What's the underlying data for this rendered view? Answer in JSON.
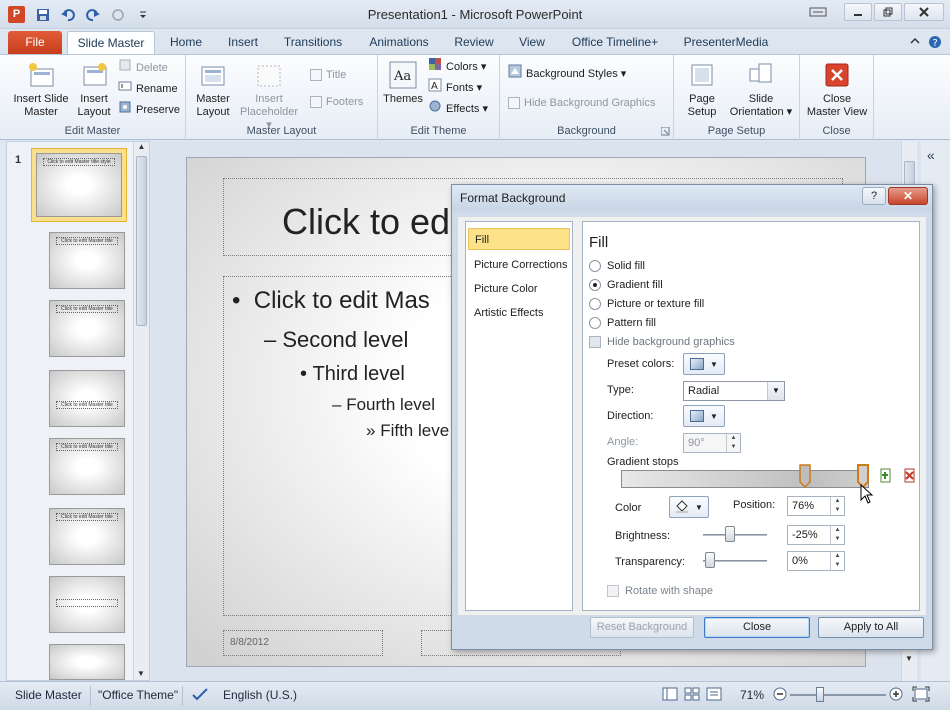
{
  "window": {
    "title": "Presentation1 - Microsoft PowerPoint",
    "app_icon": "P"
  },
  "tabs": [
    {
      "label": "File"
    },
    {
      "label": "Slide Master"
    },
    {
      "label": "Home"
    },
    {
      "label": "Insert"
    },
    {
      "label": "Transitions"
    },
    {
      "label": "Animations"
    },
    {
      "label": "Review"
    },
    {
      "label": "View"
    },
    {
      "label": "Office Timeline+"
    },
    {
      "label": "PresenterMedia"
    }
  ],
  "ribbon": {
    "edit_master": {
      "label": "Edit Master",
      "insert_slide_master": "Insert Slide\nMaster",
      "insert_layout": "Insert\nLayout",
      "delete": "Delete",
      "rename": "Rename",
      "preserve": "Preserve"
    },
    "master_layout": {
      "label": "Master Layout",
      "master_layout_btn": "Master\nLayout",
      "insert_placeholder": "Insert\nPlaceholder ▾",
      "title": "Title",
      "footers": "Footers"
    },
    "edit_theme": {
      "label": "Edit Theme",
      "themes": "Themes",
      "colors": "Colors ▾",
      "fonts": "Fonts ▾",
      "effects": "Effects ▾"
    },
    "background": {
      "label": "Background",
      "background_styles": "Background Styles ▾",
      "hide_background_graphics": "Hide Background Graphics"
    },
    "page_setup": {
      "label": "Page Setup",
      "page_setup_btn": "Page\nSetup",
      "slide_orientation": "Slide\nOrientation ▾"
    },
    "close": {
      "label": "Close",
      "close_master_view": "Close\nMaster View"
    }
  },
  "slide_pane": {
    "selected_number": "1",
    "thumbnails": [
      {
        "title": "Click to edit Master title style"
      },
      {
        "title": "Click to edit Master title style"
      },
      {
        "title": "Click to edit Master title style"
      },
      {
        "title": "Click to edit Master title style"
      },
      {
        "title": "Click to edit Master title style"
      },
      {
        "title": "Click to edit Master title style"
      },
      {
        "title": ""
      },
      {
        "title": ""
      }
    ]
  },
  "slide": {
    "title_placeholder": "Click to edit",
    "bullet1": "Click to edit Mas",
    "bullet2": "Second level",
    "bullet3": "Third level",
    "bullet4": "Fourth level",
    "bullet5": "Fifth leve",
    "footer_date": "8/8/2012"
  },
  "dialog": {
    "title": "Format Background",
    "help": "?",
    "close_x": "✕",
    "nav": [
      {
        "label": "Fill",
        "selected": true
      },
      {
        "label": "Picture Corrections",
        "selected": false
      },
      {
        "label": "Picture Color",
        "selected": false
      },
      {
        "label": "Artistic Effects",
        "selected": false
      }
    ],
    "fill": {
      "heading": "Fill",
      "solid_fill": "Solid fill",
      "gradient_fill": "Gradient fill",
      "picture_or_texture_fill": "Picture or texture fill",
      "pattern_fill": "Pattern fill",
      "hide_background_graphics": "Hide background graphics",
      "preset_colors_label": "Preset colors:",
      "type_label": "Type:",
      "type_value": "Radial",
      "direction_label": "Direction:",
      "angle_label": "Angle:",
      "angle_value": "90°",
      "gradient_stops_label": "Gradient stops",
      "color_label": "Color",
      "position_label": "Position:",
      "position_value": "76%",
      "brightness_label": "Brightness:",
      "brightness_value": "-25%",
      "transparency_label": "Transparency:",
      "transparency_value": "0%",
      "rotate_with_shape": "Rotate with shape"
    },
    "buttons": {
      "reset_background": "Reset Background",
      "close": "Close",
      "apply_to_all": "Apply to All"
    }
  },
  "status": {
    "view": "Slide Master",
    "theme": "\"Office Theme\"",
    "language": "English (U.S.)",
    "zoom": "71%"
  },
  "colors": {
    "file_tab": "#d24726",
    "dialog_selected": "#fde289",
    "ribbon_bg": "#e6edf6"
  }
}
